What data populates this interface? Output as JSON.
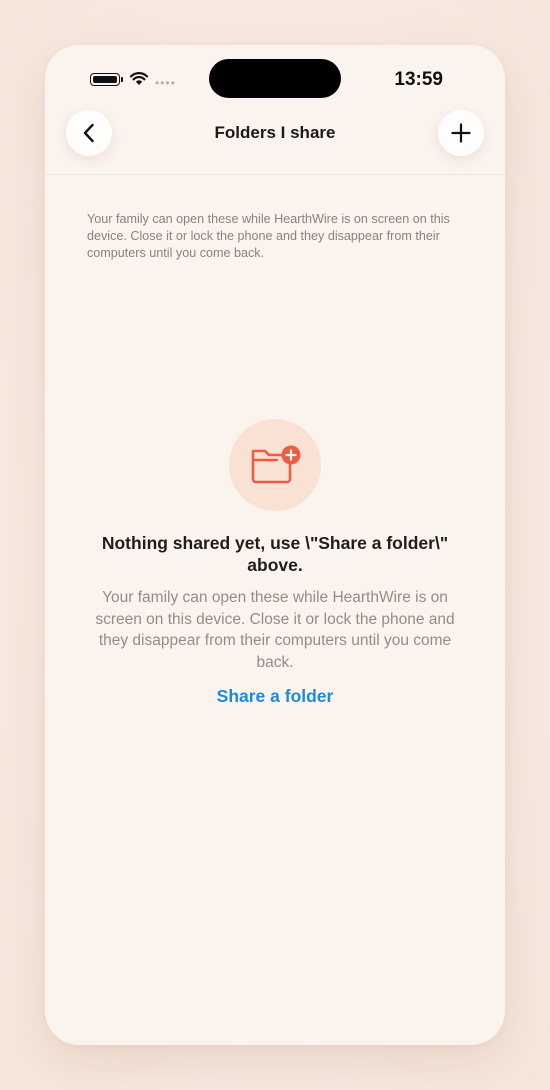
{
  "status_bar": {
    "time": "13:59",
    "signal_dots": "••••"
  },
  "nav": {
    "title": "Folders I share",
    "back_icon": "chevron-left-icon",
    "add_icon": "plus-icon"
  },
  "intro_text": "Your family can open these while HearthWire is on screen on this device. Close it or lock the phone and they disappear from their computers until you come back.",
  "empty_state": {
    "icon": "folder-add-icon",
    "title": "Nothing shared yet, use \\\"Share a folder\\\" above.",
    "subtitle": "Your family can open these while HearthWire is on screen on this device. Close it or lock the phone and they disappear from their computers until you come back.",
    "action_label": "Share a folder"
  },
  "colors": {
    "accent": "#1a8ce0",
    "folder_icon": "#ec5d44",
    "icon_circle": "#f9e1d3",
    "background": "#faf3ee"
  }
}
